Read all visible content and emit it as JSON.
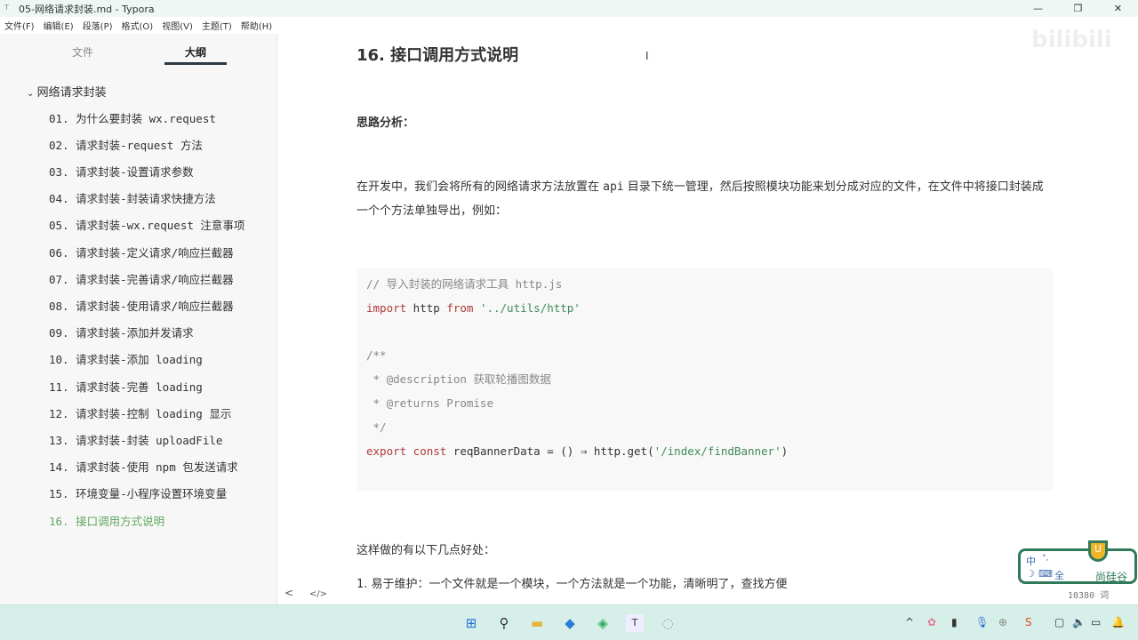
{
  "window": {
    "title": "05-网络请求封装.md - Typora",
    "app_icon": "T"
  },
  "menu": [
    "文件(F)",
    "编辑(E)",
    "段落(P)",
    "格式(O)",
    "视图(V)",
    "主题(T)",
    "帮助(H)"
  ],
  "sidebar": {
    "tabs": [
      "文件",
      "大纲"
    ],
    "active_tab": "大纲",
    "root": "网络请求封装",
    "items": [
      "01. 为什么要封装 wx.request",
      "02. 请求封装-request 方法",
      "03. 请求封装-设置请求参数",
      "04. 请求封装-封装请求快捷方法",
      "05. 请求封装-wx.request 注意事项",
      "06. 请求封装-定义请求/响应拦截器",
      "07. 请求封装-完善请求/响应拦截器",
      "08. 请求封装-使用请求/响应拦截器",
      "09. 请求封装-添加并发请求",
      "10. 请求封装-添加 loading",
      "11. 请求封装-完善 loading",
      "12. 请求封装-控制 loading 显示",
      "13. 请求封装-封装 uploadFile",
      "14. 请求封装-使用 npm 包发送请求",
      "15. 环境变量-小程序设置环境变量",
      "16. 接口调用方式说明"
    ],
    "active_color": "#5fa85f",
    "footer": [
      "<",
      "</>"
    ]
  },
  "doc": {
    "heading": "16. 接口调用方式说明",
    "p1": "思路分析：",
    "p2a": "在开发中，我们会将所有的网络请求方法放置在 ",
    "p2code": "api",
    "p2b": " 目录下统一管理，然后按照模块功能来划分成对应的文件，在文件中将接口封装成一个个方法单独导出，例如：",
    "code": {
      "l1": "// 导入封装的网络请求工具 http.js",
      "l2kw1": "import",
      "l2a": " http ",
      "l2kw2": "from",
      "l2str": " '../utils/http'",
      "l4": "/**",
      "l5": " * @description 获取轮播图数据",
      "l6": " * @returns Promise",
      "l7": " */",
      "l8kw1": "export",
      "l8kw2": " const",
      "l8a": " reqBannerData = () ⇒ http.get(",
      "l8str": "'/index/findBanner'",
      "l8b": ")"
    },
    "p3": "这样做的有以下几点好处：",
    "p4": "1. 易于维护：一个文件就是一个模块，一个方法就是一个功能，清晰明了，查找方便",
    "word_count": "10380 词"
  },
  "ime": {
    "lang": "中",
    "full": "全",
    "brand": "尚硅谷",
    "badge": "U"
  },
  "watermark": "bilibili"
}
